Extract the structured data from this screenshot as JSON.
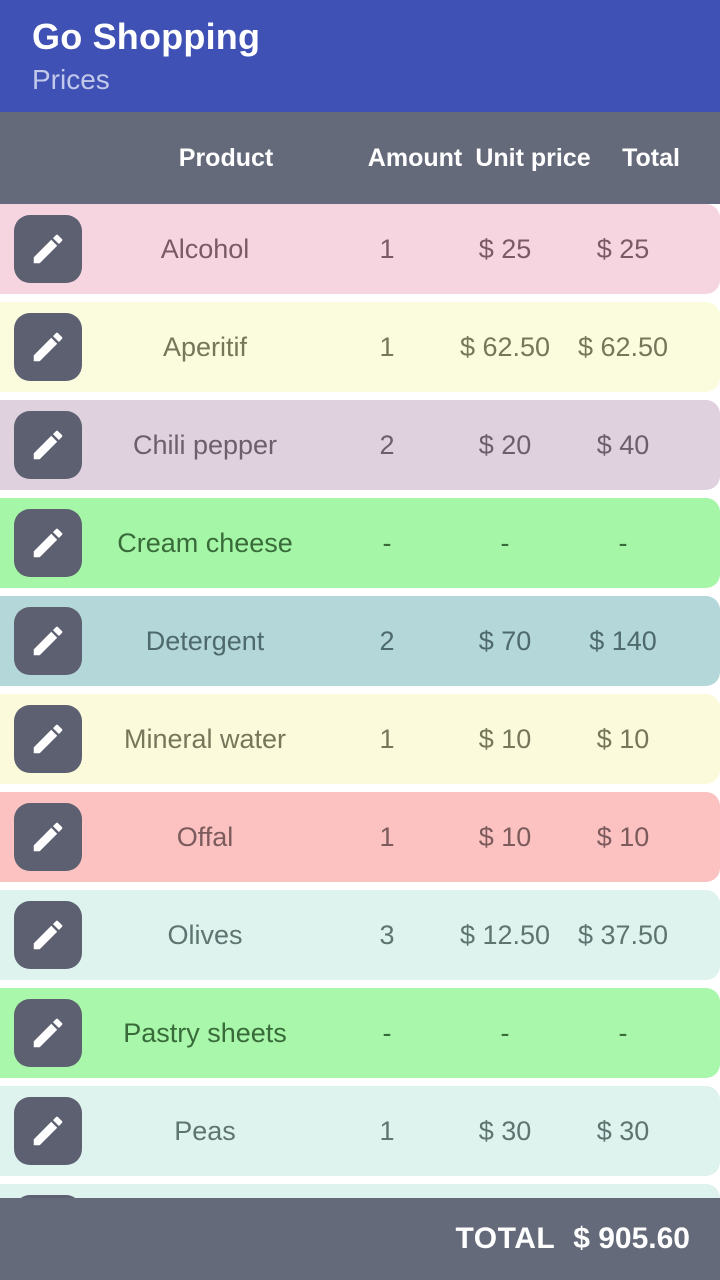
{
  "appbar": {
    "title": "Go Shopping",
    "subtitle": "Prices"
  },
  "table": {
    "headers": {
      "edit": "",
      "product": "Product",
      "amount": "Amount",
      "unit_price": "Unit price",
      "total": "Total"
    },
    "edit_icon": "pencil-icon",
    "rows": [
      {
        "product": "Alcohol",
        "amount": "1",
        "unit_price": "$ 25",
        "total": "$ 25",
        "bg": "#f7d5e0",
        "fg": "#7a5a66"
      },
      {
        "product": "Aperitif",
        "amount": "1",
        "unit_price": "$ 62.50",
        "total": "$ 62.50",
        "bg": "#fbfcdd",
        "fg": "#75765a"
      },
      {
        "product": "Chili pepper",
        "amount": "2",
        "unit_price": "$ 20",
        "total": "$ 40",
        "bg": "#dfd1dd",
        "fg": "#6d5f6b"
      },
      {
        "product": "Cream cheese",
        "amount": "-",
        "unit_price": "-",
        "total": "-",
        "bg": "#a6f6a8",
        "fg": "#386b39"
      },
      {
        "product": "Detergent",
        "amount": "2",
        "unit_price": "$ 70",
        "total": "$ 140",
        "bg": "#b4d7d9",
        "fg": "#4e6a6c"
      },
      {
        "product": "Mineral water",
        "amount": "1",
        "unit_price": "$ 10",
        "total": "$ 10",
        "bg": "#fbfbdc",
        "fg": "#76765a"
      },
      {
        "product": "Offal",
        "amount": "1",
        "unit_price": "$ 10",
        "total": "$ 10",
        "bg": "#fcc2c1",
        "fg": "#7b5b5b"
      },
      {
        "product": "Olives",
        "amount": "3",
        "unit_price": "$ 12.50",
        "total": "$ 37.50",
        "bg": "#def3ee",
        "fg": "#5d7470"
      },
      {
        "product": "Pastry sheets",
        "amount": "-",
        "unit_price": "-",
        "total": "-",
        "bg": "#a8f7aa",
        "fg": "#386b39"
      },
      {
        "product": "Peas",
        "amount": "1",
        "unit_price": "$ 30",
        "total": "$ 30",
        "bg": "#def3ee",
        "fg": "#5d7470"
      },
      {
        "product": "",
        "amount": "",
        "unit_price": "",
        "total": "",
        "bg": "#def3ee",
        "fg": "#5d7470"
      }
    ]
  },
  "footer": {
    "total_label": "TOTAL",
    "total_value": "$ 905.60"
  },
  "colors": {
    "appbar_bg": "#3f51b5",
    "header_bg": "#656a7a",
    "edit_button_bg": "#5d6070",
    "total_bar_bg": "#656a7a"
  }
}
